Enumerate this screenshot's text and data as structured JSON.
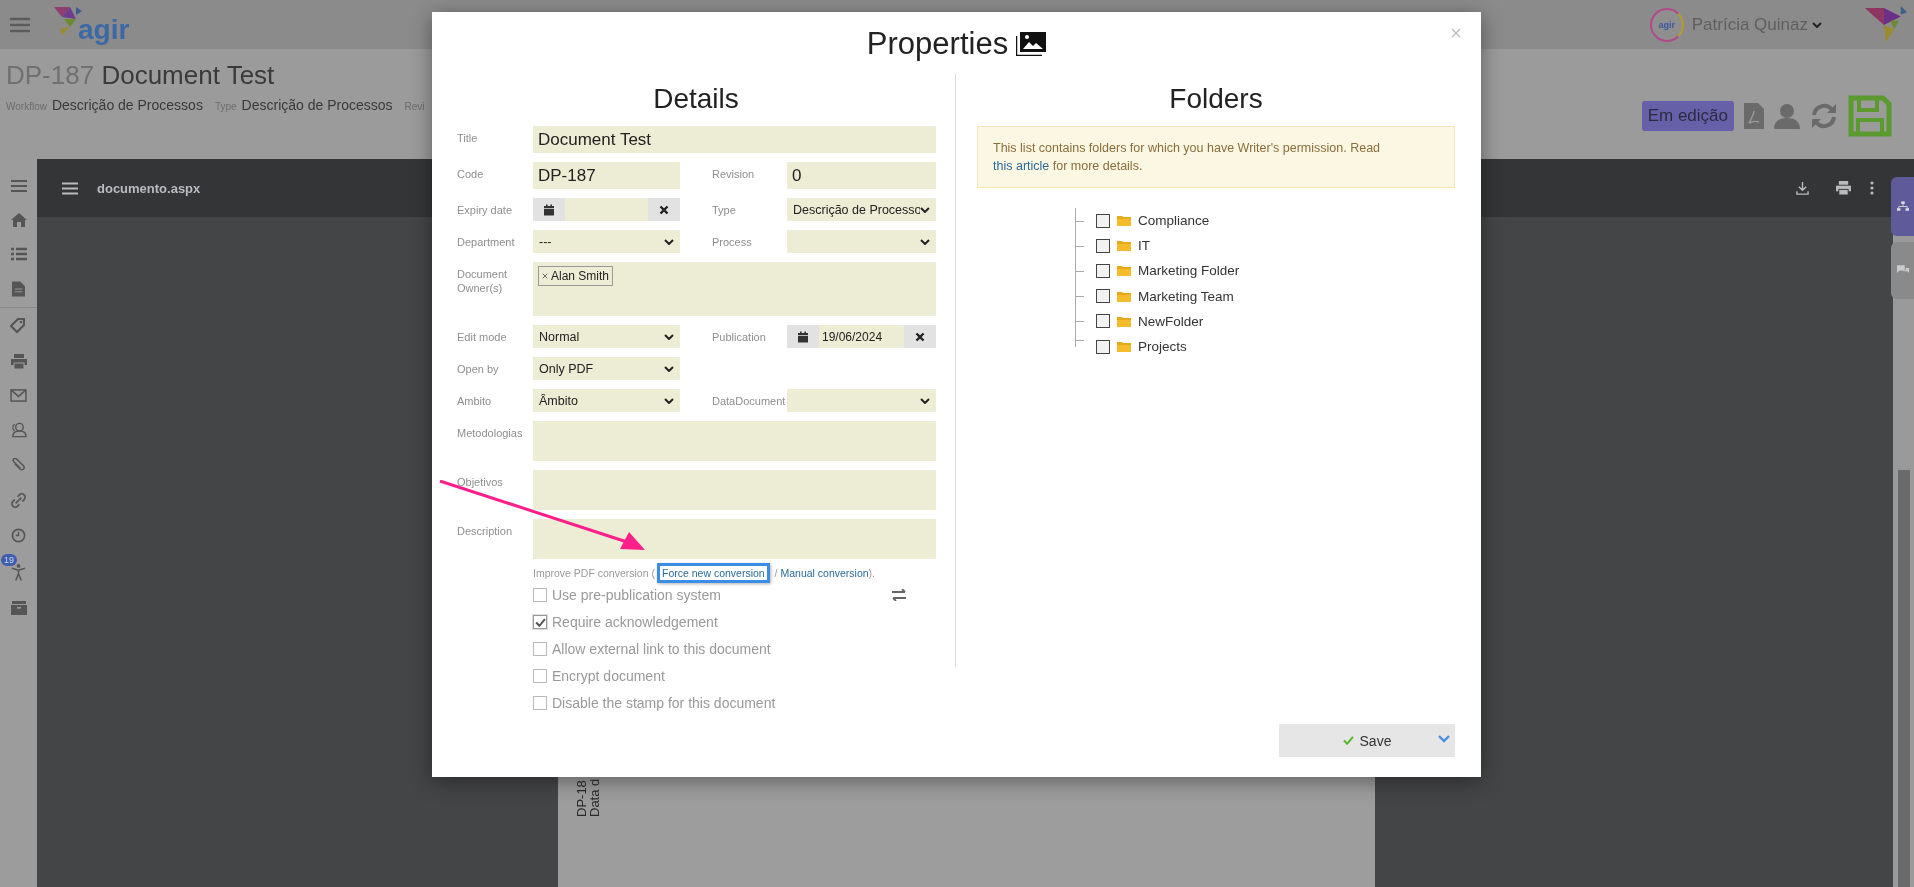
{
  "topbar": {
    "logo_text": "agir",
    "user": {
      "avatar_text": "agir",
      "name": "Patrícia Quinaz"
    }
  },
  "document": {
    "code": "DP-187",
    "title": "Document Test",
    "meta": [
      {
        "label": "Workflow",
        "value": "Descrição de Processos"
      },
      {
        "label": "Type",
        "value": "Descrição de Processos"
      },
      {
        "label": "Revi"
      }
    ],
    "status": "Em edição"
  },
  "sidebar": {
    "badge": "19"
  },
  "viewer": {
    "filename": "documento.aspx",
    "page_lines": [
      "DP-18",
      "Data d"
    ]
  },
  "dialog": {
    "title": "Properties",
    "details": {
      "heading": "Details",
      "rows": [
        {
          "fields": [
            {
              "label": "Title",
              "kind": "text",
              "value": "Document Test"
            }
          ]
        },
        {
          "fields": [
            {
              "label": "Code",
              "kind": "text",
              "value": "DP-187"
            },
            {
              "label": "Revision",
              "kind": "text",
              "value": "0"
            }
          ]
        },
        {
          "fields": [
            {
              "label": "Expiry date",
              "kind": "date"
            },
            {
              "label": "Type",
              "kind": "select",
              "value": "Descrição de Processo"
            }
          ]
        },
        {
          "fields": [
            {
              "label": "Department",
              "kind": "select",
              "value": "---"
            },
            {
              "label": "Process",
              "kind": "select"
            }
          ]
        },
        {
          "fields": [
            {
              "label": "Document Owner(s)",
              "kind": "tags",
              "tags": [
                "Alan Smith"
              ]
            }
          ]
        },
        {
          "fields": [
            {
              "label": "Edit mode",
              "kind": "select",
              "value": "Normal"
            },
            {
              "label": "Publication",
              "kind": "date",
              "value": "19/06/2024"
            }
          ]
        },
        {
          "fields": [
            {
              "label": "Open by",
              "kind": "select",
              "value": "Only PDF"
            }
          ]
        },
        {
          "fields": [
            {
              "label": "Ambito",
              "kind": "select",
              "value": "Âmbito"
            },
            {
              "label": "DataDocument",
              "kind": "select"
            }
          ]
        },
        {
          "fields": [
            {
              "label": "Metodologias",
              "kind": "textarea"
            }
          ]
        },
        {
          "fields": [
            {
              "label": "Objetivos",
              "kind": "textarea"
            }
          ]
        },
        {
          "fields": [
            {
              "label": "Description",
              "kind": "textarea"
            }
          ]
        }
      ],
      "pdf_note": {
        "text_before": "Improve PDF conversion (",
        "links": [
          "Force new conversion",
          "Manual conversion"
        ],
        "separator": " / ",
        "text_after": ")."
      },
      "options": [
        {
          "label": "Use pre-publication system",
          "checked": false,
          "swap": true
        },
        {
          "label": "Require acknowledgement",
          "checked": true,
          "swap": false
        },
        {
          "label": "Allow external link to this document",
          "checked": false,
          "swap": false
        },
        {
          "label": "Encrypt document",
          "checked": false,
          "swap": false
        },
        {
          "label": "Disable the stamp for this document",
          "checked": false,
          "swap": false
        }
      ]
    },
    "folders": {
      "heading": "Folders",
      "notice": {
        "text_before": "This list contains folders for which you have Writer's permission. Read ",
        "link": "this article",
        "text_after": " for more details."
      },
      "items": [
        {
          "name": "Compliance",
          "checked": false
        },
        {
          "name": "IT",
          "checked": false
        },
        {
          "name": "Marketing Folder",
          "checked": false
        },
        {
          "name": "Marketing Team",
          "checked": false
        },
        {
          "name": "NewFolder",
          "checked": false
        },
        {
          "name": "Projects",
          "checked": false
        }
      ]
    },
    "save_button": "Save"
  }
}
